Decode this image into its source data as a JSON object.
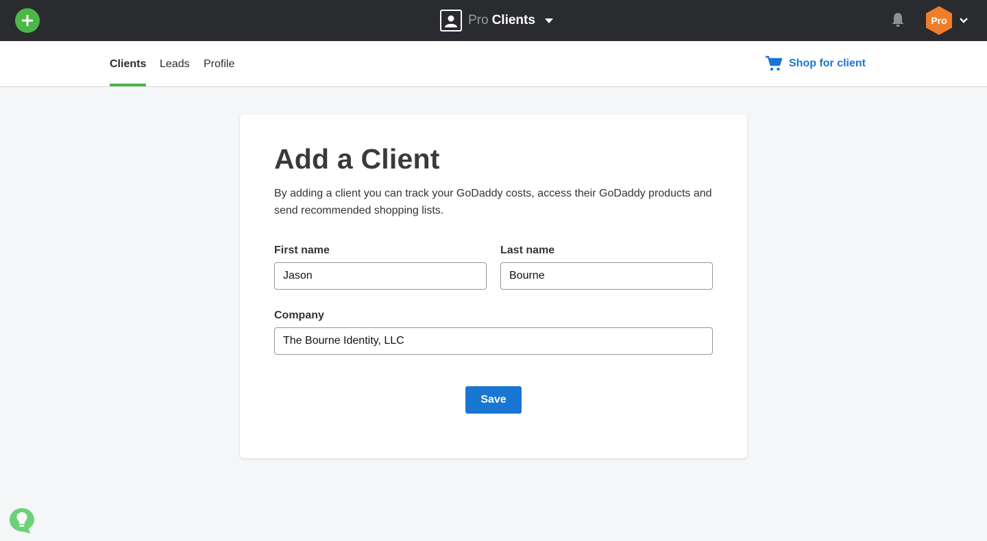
{
  "topbar": {
    "brand_pro": "Pro",
    "brand_clients": "Clients",
    "avatar_label": "Pro",
    "icons": [
      "plus-icon",
      "client-card-icon",
      "caret-down-icon",
      "bell-icon",
      "chevron-down-icon"
    ]
  },
  "nav": {
    "tabs": [
      {
        "label": "Clients",
        "active": true
      },
      {
        "label": "Leads",
        "active": false
      },
      {
        "label": "Profile",
        "active": false
      }
    ],
    "shop_label": "Shop for client"
  },
  "form": {
    "title": "Add a Client",
    "description": "By adding a client you can track your GoDaddy costs, access their GoDaddy products and send recommended shopping lists.",
    "first_name": {
      "label": "First name",
      "value": "Jason"
    },
    "last_name": {
      "label": "Last name",
      "value": "Bourne"
    },
    "company": {
      "label": "Company",
      "value": "The Bourne Identity, LLC"
    },
    "save_label": "Save"
  },
  "colors": {
    "topbar": "#2a2b2f",
    "accent_green": "#4cb848",
    "primary_blue": "#1976d2",
    "avatar_orange": "#f07d2a"
  }
}
